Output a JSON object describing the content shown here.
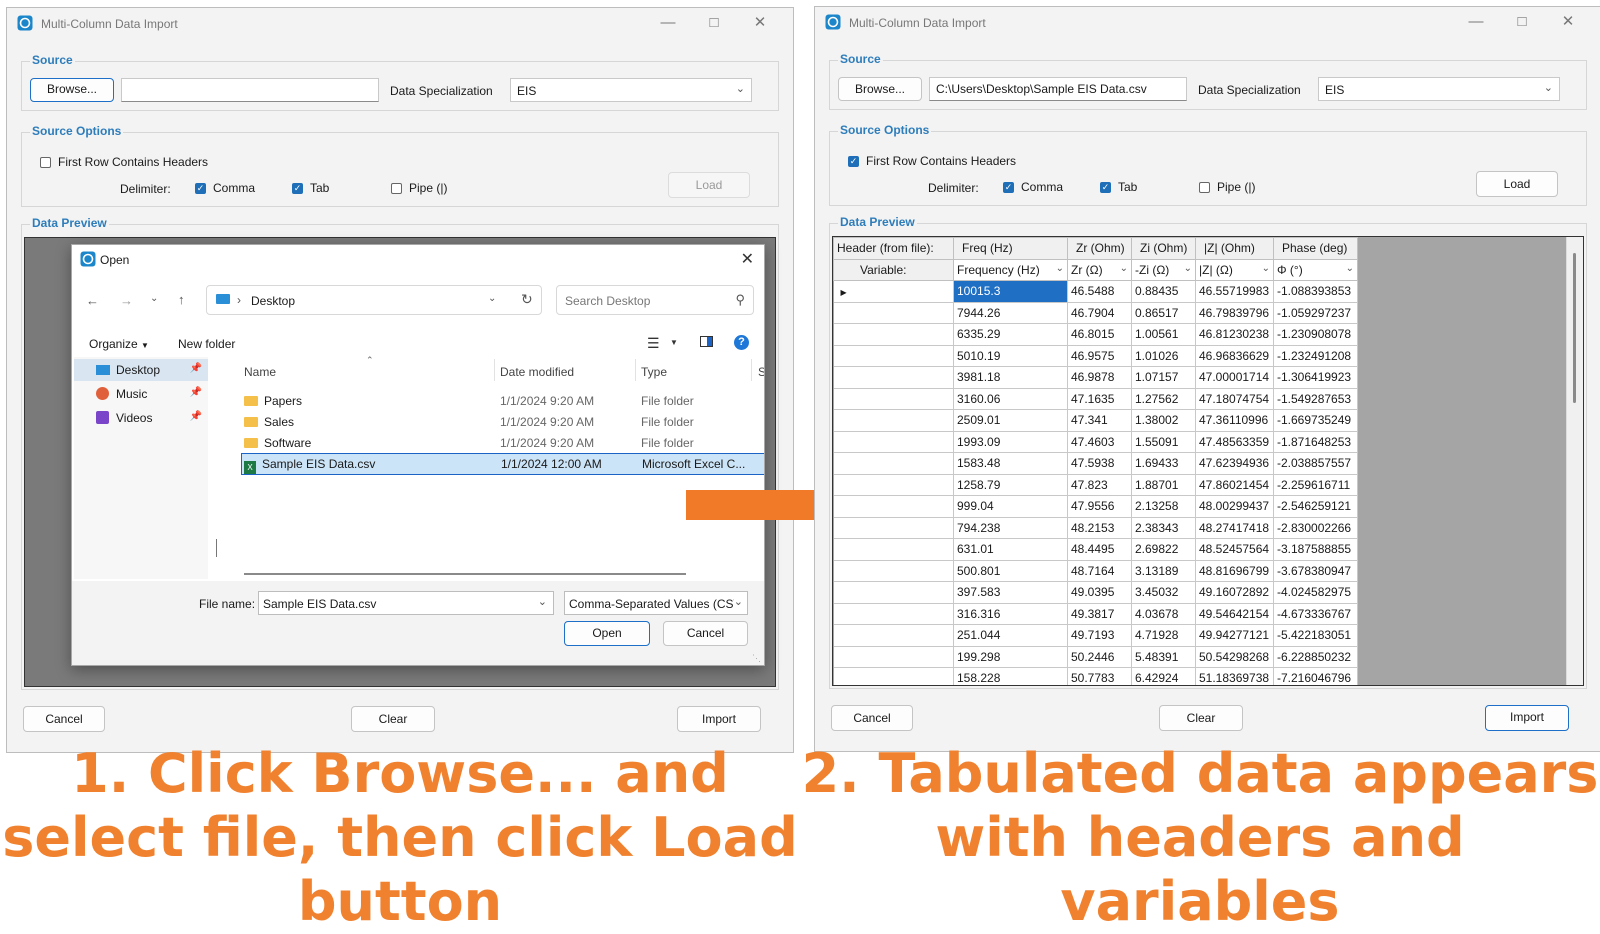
{
  "left_window": {
    "title": "Multi-Column Data Import",
    "source": {
      "legend": "Source",
      "browse_label": "Browse...",
      "path_value": "",
      "spec_label": "Data Specialization",
      "spec_value": "EIS"
    },
    "options": {
      "legend": "Source Options",
      "headers_label": "First Row Contains Headers",
      "headers_checked": false,
      "delimiter_label": "Delimiter:",
      "comma_label": "Comma",
      "tab_label": "Tab",
      "pipe_label": "Pipe (|)",
      "load_label": "Load"
    },
    "preview_legend": "Data Preview",
    "cancel_label": "Cancel",
    "clear_label": "Clear",
    "import_label": "Import"
  },
  "open_dialog": {
    "title": "Open",
    "breadcrumb": "Desktop",
    "search_placeholder": "Search Desktop",
    "organize_label": "Organize",
    "new_folder_label": "New folder",
    "sidebar": [
      {
        "label": "Desktop"
      },
      {
        "label": "Music"
      },
      {
        "label": "Videos"
      }
    ],
    "columns": {
      "name": "Name",
      "date": "Date modified",
      "type": "Type",
      "size": "S"
    },
    "files": [
      {
        "name": "Papers",
        "date": "1/1/2024 9:20 AM",
        "type": "File folder"
      },
      {
        "name": "Sales",
        "date": "1/1/2024 9:20 AM",
        "type": "File folder"
      },
      {
        "name": "Software",
        "date": "1/1/2024 9:20 AM",
        "type": "File folder"
      },
      {
        "name": "Sample EIS Data.csv",
        "date": "1/1/2024 12:00 AM",
        "type": "Microsoft Excel C..."
      }
    ],
    "file_name_label": "File name:",
    "file_name_value": "Sample EIS Data.csv",
    "filter_value": "Comma-Separated Values (CSV",
    "open_label": "Open",
    "cancel_label": "Cancel"
  },
  "right_window": {
    "title": "Multi-Column Data Import",
    "source": {
      "legend": "Source",
      "browse_label": "Browse...",
      "path_value": "C:\\Users\\Desktop\\Sample EIS Data.csv",
      "spec_label": "Data Specialization",
      "spec_value": "EIS"
    },
    "options": {
      "legend": "Source Options",
      "headers_label": "First Row Contains Headers",
      "headers_checked": true,
      "delimiter_label": "Delimiter:",
      "comma_label": "Comma",
      "tab_label": "Tab",
      "pipe_label": "Pipe (|)",
      "load_label": "Load"
    },
    "preview_legend": "Data Preview",
    "grid": {
      "header_label": "Header (from file):",
      "variable_label": "Variable:",
      "headers": [
        "Freq (Hz)",
        "Zr (Ohm)",
        "Zi (Ohm)",
        "|Z| (Ohm)",
        "Phase (deg)"
      ],
      "variables": [
        "Frequency (Hz)",
        "Zr (Ω)",
        "-Zi (Ω)",
        "|Z| (Ω)",
        "Φ (°)"
      ],
      "rows": [
        [
          "10015.3",
          "46.5488",
          "0.88435",
          "46.55719983",
          "-1.088393853"
        ],
        [
          "7944.26",
          "46.7904",
          "0.86517",
          "46.79839796",
          "-1.059297237"
        ],
        [
          "6335.29",
          "46.8015",
          "1.00561",
          "46.81230238",
          "-1.230908078"
        ],
        [
          "5010.19",
          "46.9575",
          "1.01026",
          "46.96836629",
          "-1.232491208"
        ],
        [
          "3981.18",
          "46.9878",
          "1.07157",
          "47.00001714",
          "-1.306419923"
        ],
        [
          "3160.06",
          "47.1635",
          "1.27562",
          "47.18074754",
          "-1.549287653"
        ],
        [
          "2509.01",
          "47.341",
          "1.38002",
          "47.36110996",
          "-1.669735249"
        ],
        [
          "1993.09",
          "47.4603",
          "1.55091",
          "47.48563359",
          "-1.871648253"
        ],
        [
          "1583.48",
          "47.5938",
          "1.69433",
          "47.62394936",
          "-2.038857557"
        ],
        [
          "1258.79",
          "47.823",
          "1.88701",
          "47.86021454",
          "-2.259616711"
        ],
        [
          "999.04",
          "47.9556",
          "2.13258",
          "48.00299437",
          "-2.546259121"
        ],
        [
          "794.238",
          "48.2153",
          "2.38343",
          "48.27417418",
          "-2.830002266"
        ],
        [
          "631.01",
          "48.4495",
          "2.69822",
          "48.52457564",
          "-3.187588855"
        ],
        [
          "500.801",
          "48.7164",
          "3.13189",
          "48.81696799",
          "-3.678380947"
        ],
        [
          "397.583",
          "49.0395",
          "3.45032",
          "49.16072892",
          "-4.024582975"
        ],
        [
          "316.316",
          "49.3817",
          "4.03678",
          "49.54642154",
          "-4.673336767"
        ],
        [
          "251.044",
          "49.7193",
          "4.71928",
          "49.94277121",
          "-5.422183051"
        ],
        [
          "199.298",
          "50.2446",
          "5.48391",
          "50.54298268",
          "-6.228850232"
        ],
        [
          "158.228",
          "50.7783",
          "6.42924",
          "51.18369738",
          "-7.216046796"
        ]
      ]
    },
    "cancel_label": "Cancel",
    "clear_label": "Clear",
    "import_label": "Import"
  },
  "captions": {
    "left": "1. Click Browse... and select file, then click Load button",
    "right": "2. Tabulated data appears with headers and variables"
  },
  "colors": {
    "accent": "#2e7dbb",
    "caption": "#f0822f",
    "arrow": "#f07a28",
    "selection": "#1f6fc5"
  }
}
